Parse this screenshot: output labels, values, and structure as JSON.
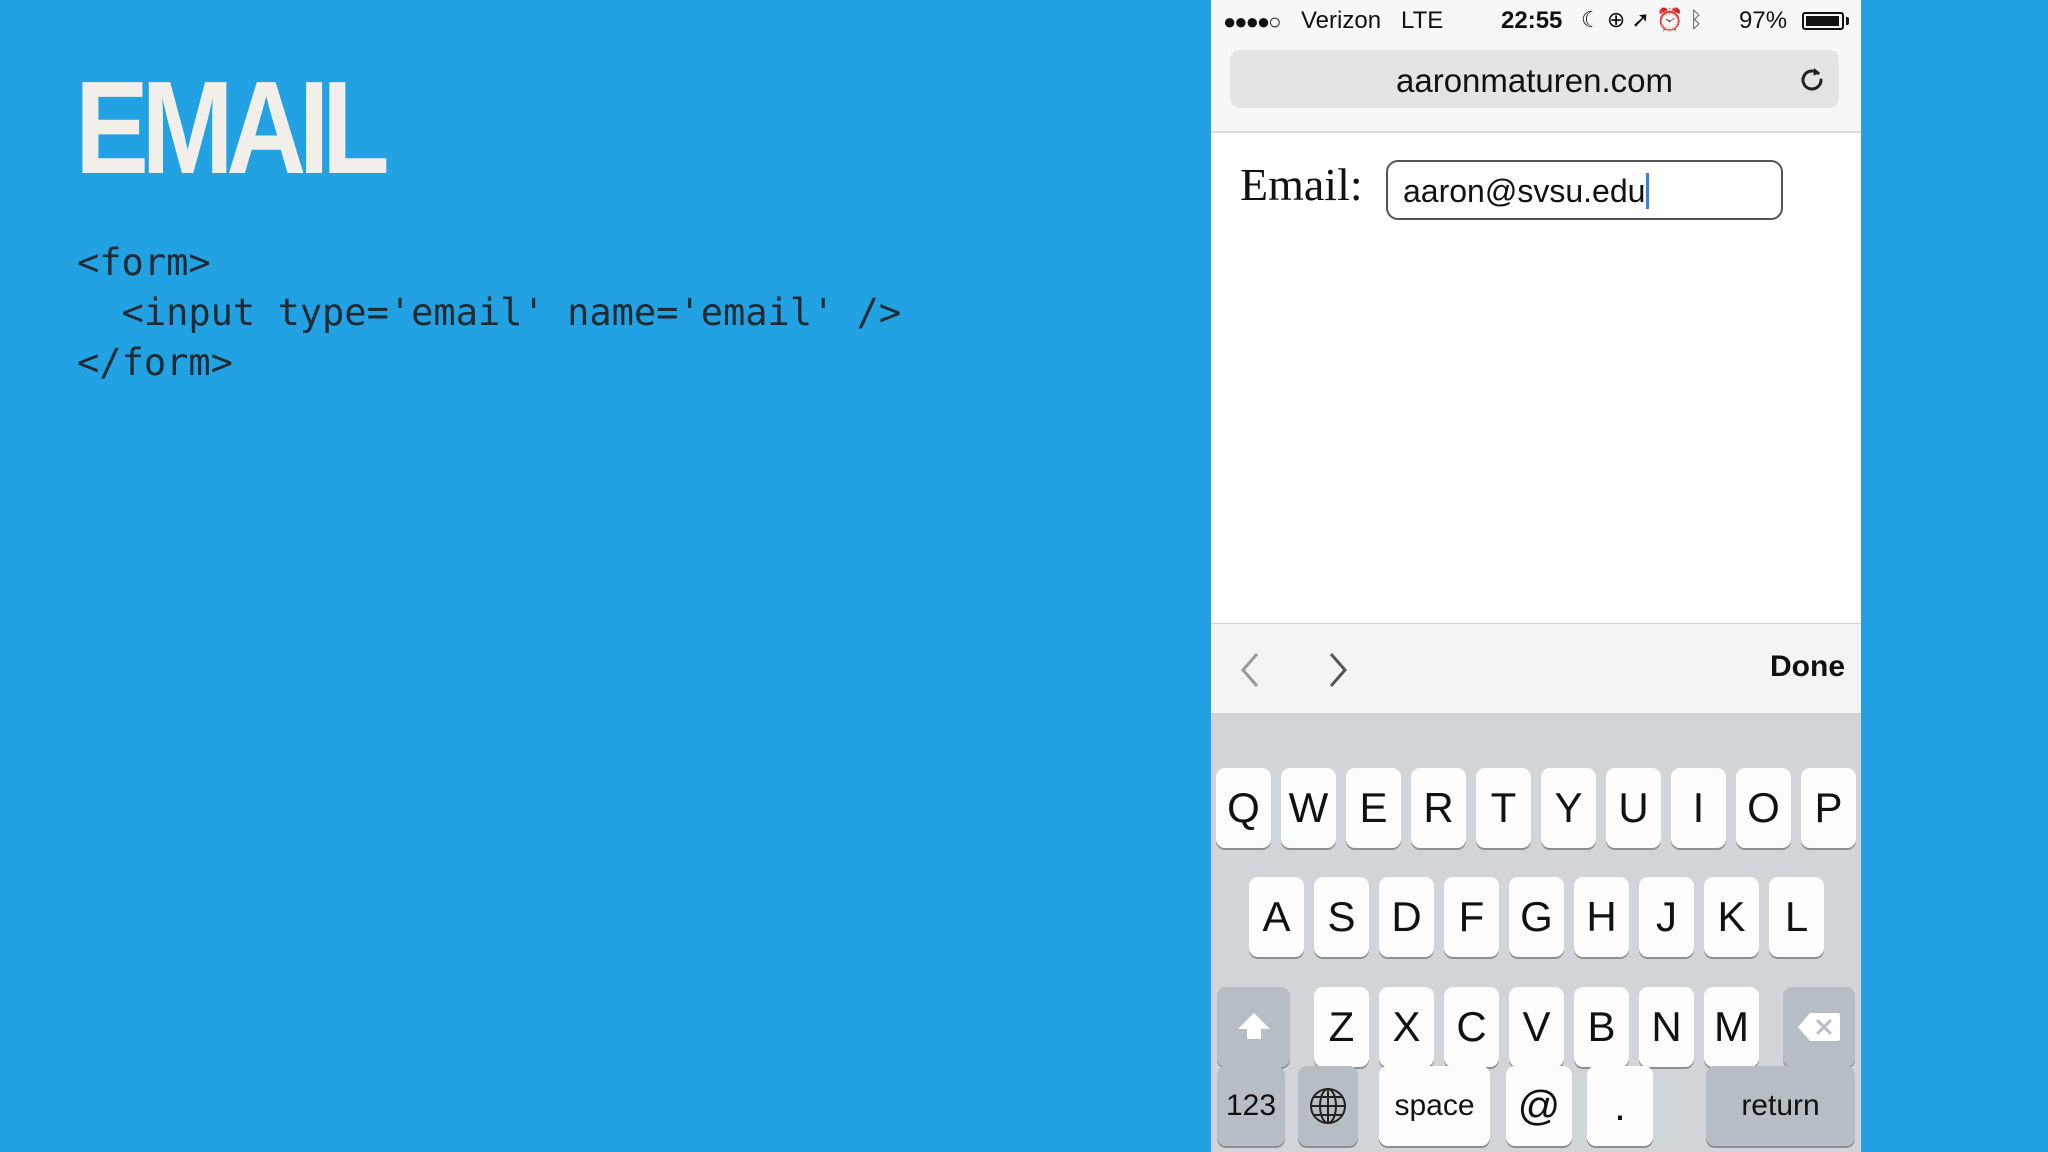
{
  "slide": {
    "title": "EMAIL",
    "code": "<form>\n  <input type='email' name='email' />\n</form>"
  },
  "phone": {
    "status_bar": {
      "signal": "●●●●○",
      "carrier": "Verizon",
      "network": "LTE",
      "time": "22:55",
      "icons": [
        "moon-icon",
        "rotation-lock-icon",
        "location-arrow-icon",
        "alarm-icon",
        "bluetooth-icon"
      ],
      "battery_percent": "97%",
      "battery_level": 0.97
    },
    "browser": {
      "url": "aaronmaturen.com",
      "reload_icon": "reload-icon"
    },
    "page": {
      "email_label": "Email:",
      "email_value": "aaron@svsu.edu"
    },
    "accessory_bar": {
      "done_label": "Done"
    },
    "keyboard": {
      "row1": [
        "Q",
        "W",
        "E",
        "R",
        "T",
        "Y",
        "U",
        "I",
        "O",
        "P"
      ],
      "row2": [
        "A",
        "S",
        "D",
        "F",
        "G",
        "H",
        "J",
        "K",
        "L"
      ],
      "row3": [
        "Z",
        "X",
        "C",
        "V",
        "B",
        "N",
        "M"
      ],
      "numbers_label": "123",
      "space_label": "space",
      "at_label": "@",
      "dot_label": ".",
      "return_label": "return"
    }
  }
}
